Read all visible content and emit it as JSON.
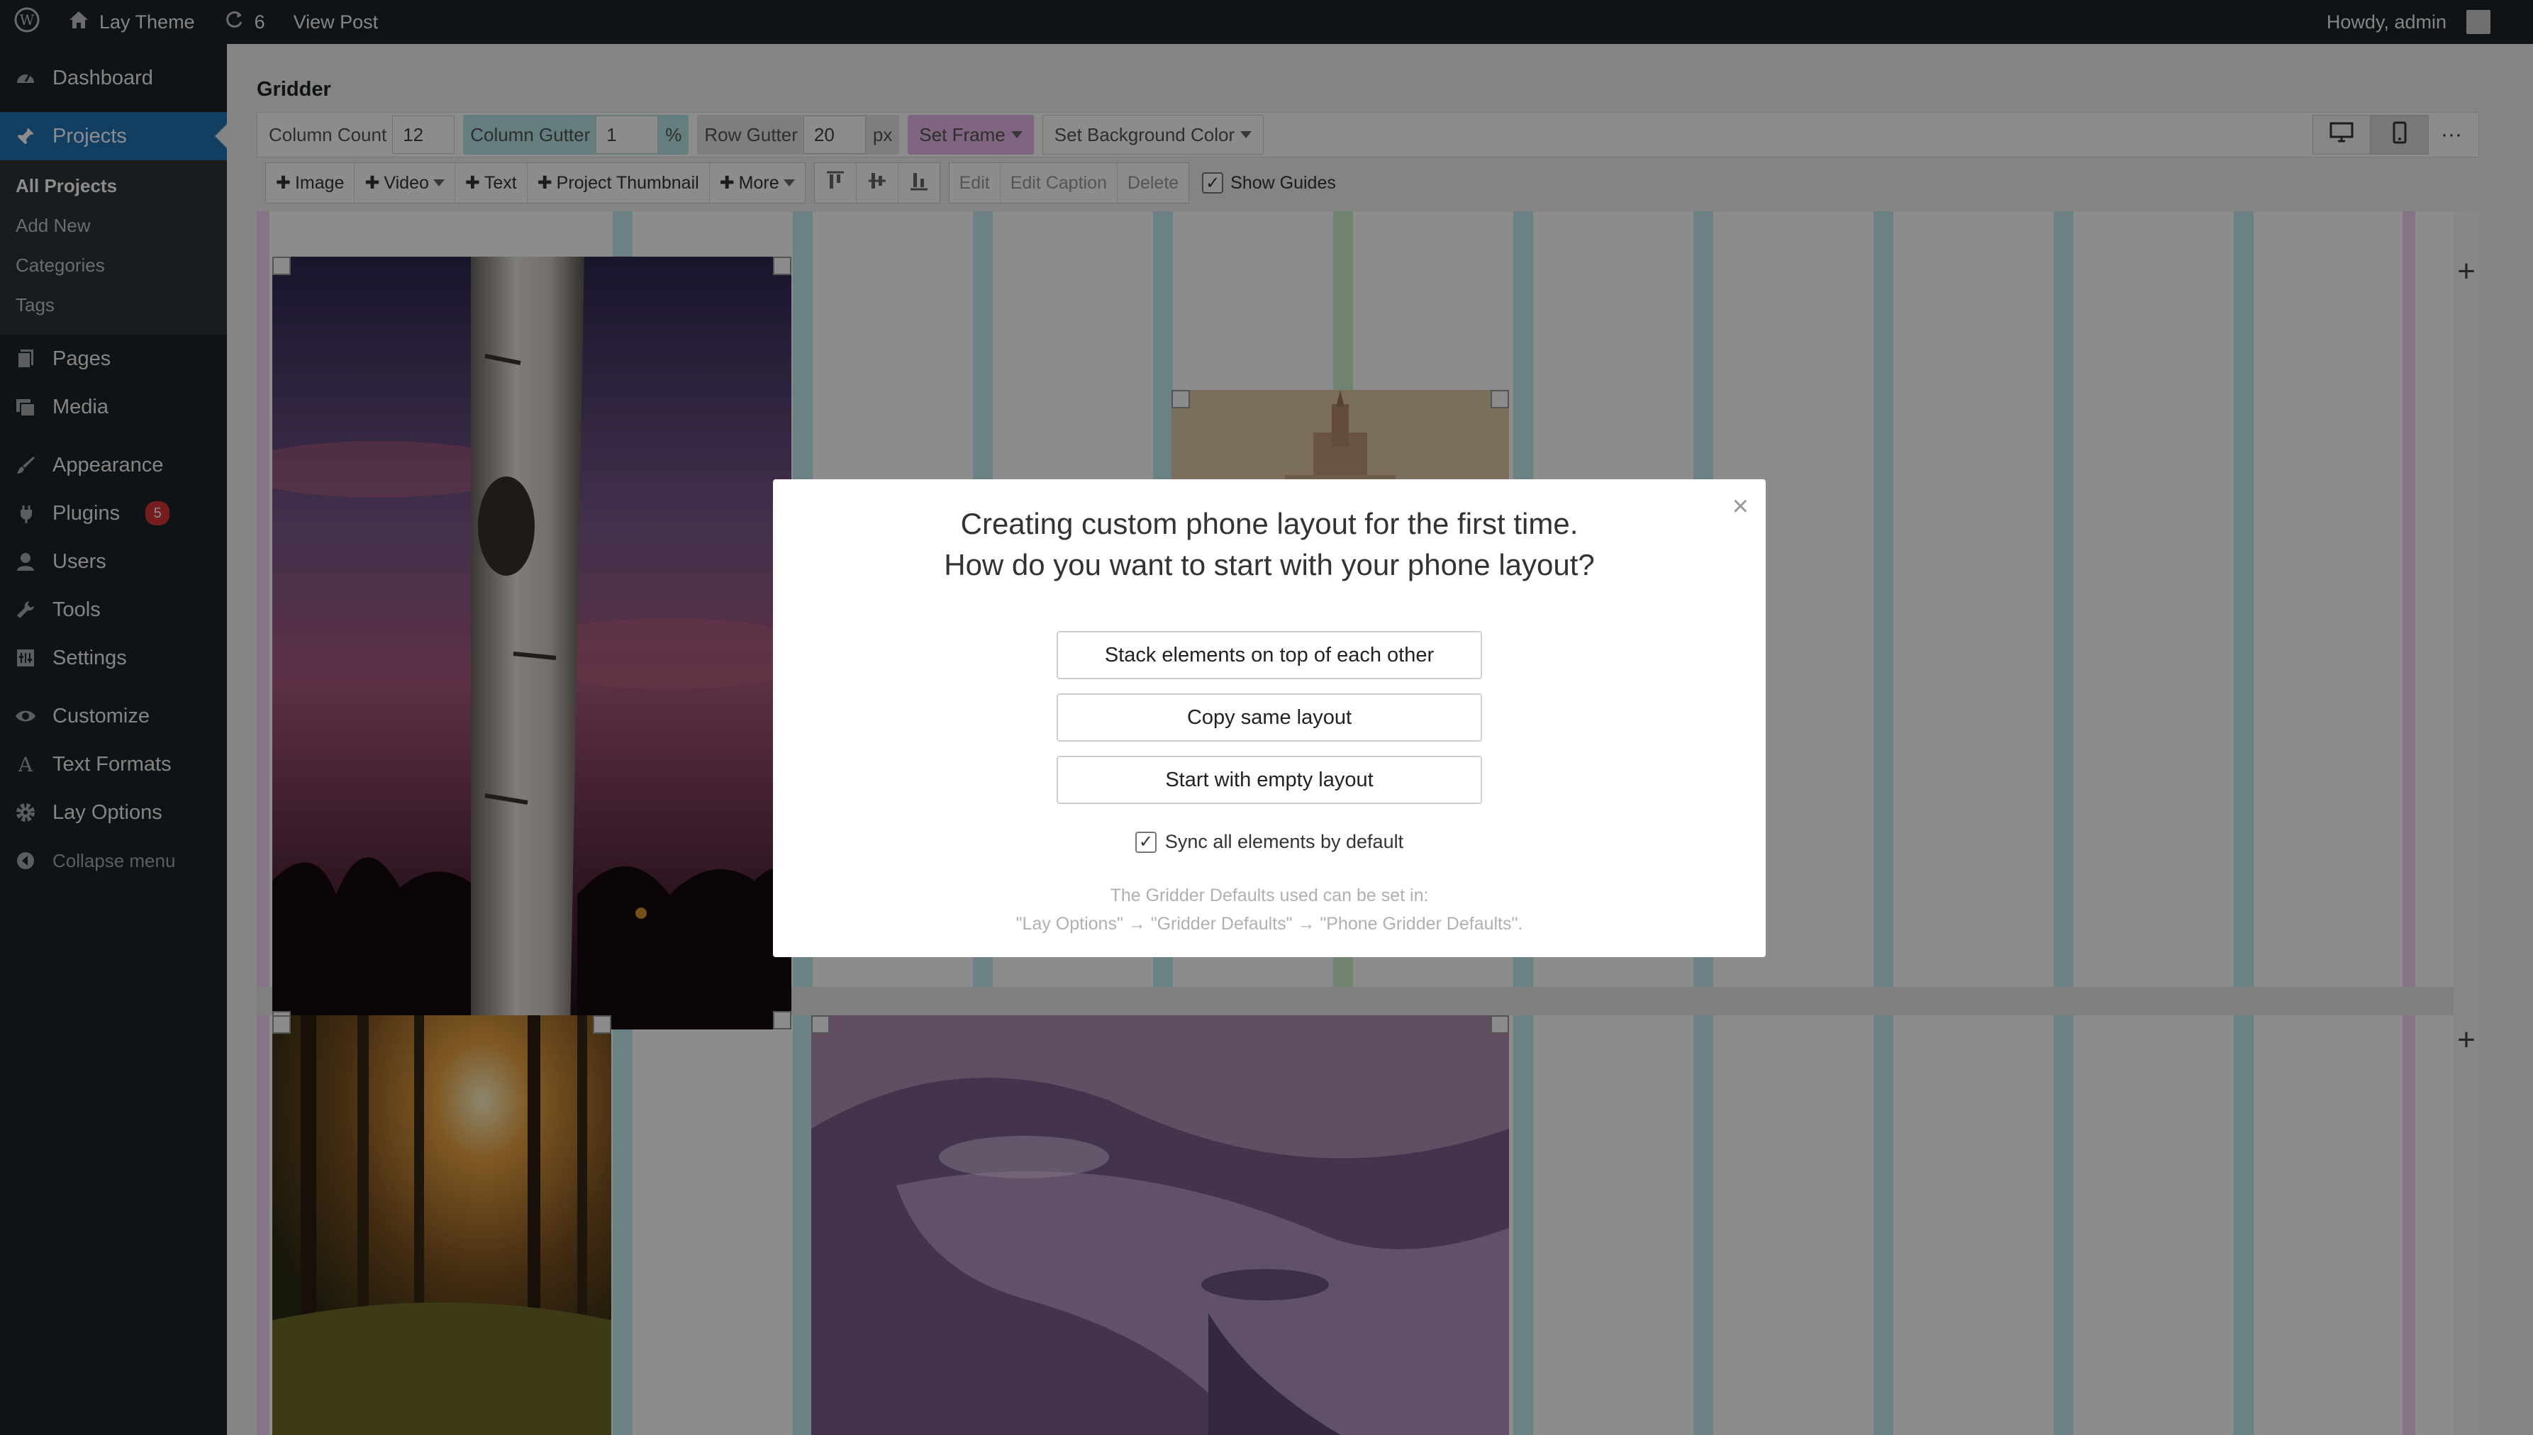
{
  "adminbar": {
    "site_name": "Lay Theme",
    "updates_count": "6",
    "view_post": "View Post",
    "howdy": "Howdy, admin"
  },
  "sidebar": {
    "dashboard": "Dashboard",
    "projects": "Projects",
    "projects_sub": [
      "All Projects",
      "Add New",
      "Categories",
      "Tags"
    ],
    "pages": "Pages",
    "media": "Media",
    "appearance": "Appearance",
    "plugins": "Plugins",
    "plugins_badge": "5",
    "users": "Users",
    "tools": "Tools",
    "settings": "Settings",
    "customize": "Customize",
    "text_formats": "Text Formats",
    "lay_options": "Lay Options",
    "collapse": "Collapse menu"
  },
  "gridder": {
    "title": "Gridder",
    "column_count_label": "Column Count",
    "column_count": "12",
    "column_gutter_label": "Column Gutter",
    "column_gutter": "1",
    "column_gutter_unit": "%",
    "row_gutter_label": "Row Gutter",
    "row_gutter": "20",
    "row_gutter_unit": "px",
    "set_frame": "Set Frame",
    "set_bg": "Set Background Color",
    "add_image": "Image",
    "add_video": "Video",
    "add_text": "Text",
    "add_project_thumbnail": "Project Thumbnail",
    "add_more": "More",
    "edit": "Edit",
    "edit_caption": "Edit Caption",
    "delete": "Delete",
    "show_guides": "Show Guides"
  },
  "modal": {
    "title_line1": "Creating custom phone layout for the first time.",
    "title_line2": "How do you want to start with your phone layout?",
    "btn_stack": "Stack elements on top of each other",
    "btn_copy": "Copy same layout",
    "btn_empty": "Start with empty layout",
    "sync_label": "Sync all elements by default",
    "note_line1": "The Gridder Defaults used can be set in:",
    "note_line2": "\"Lay Options\" → \"Gridder Defaults\" → \"Phone Gridder Defaults\"."
  }
}
